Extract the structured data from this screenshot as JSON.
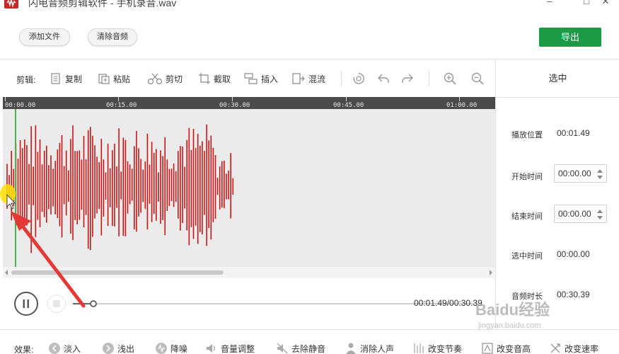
{
  "window": {
    "title": "闪电音频剪辑软件 - 手机录音.wav",
    "controls": [
      "–",
      "□",
      "✕"
    ]
  },
  "topbar": {
    "add_file": "添加文件",
    "clear_audio": "清除音频",
    "export": "导出"
  },
  "toolbar": {
    "label": "剪辑:",
    "items": [
      {
        "label": "复制",
        "icon": "copy-icon"
      },
      {
        "label": "粘贴",
        "icon": "paste-icon"
      },
      {
        "label": "剪切",
        "icon": "scissors-icon"
      },
      {
        "label": "截取",
        "icon": "crop-icon"
      },
      {
        "label": "插入",
        "icon": "insert-icon"
      },
      {
        "label": "混流",
        "icon": "mix-icon"
      }
    ],
    "icon_buttons": [
      "reset-icon",
      "undo-icon",
      "redo-icon",
      "zoom-in-icon",
      "zoom-out-icon"
    ]
  },
  "timeline": {
    "ticks": [
      "00:00.00",
      "00:15.00",
      "00:30.00",
      "00:45.00",
      "01:00.00"
    ]
  },
  "right_panel": {
    "header": "选中",
    "play_position_label": "播放位置",
    "play_position_value": "00:01.49",
    "start_time_label": "开始时间",
    "start_time_value": "00:00.00",
    "end_time_label": "结束时间",
    "end_time_value": "00:00.00",
    "selected_time_label": "选中时间",
    "selected_time_value": "00:00.00",
    "duration_label": "音频时长",
    "duration_value": "00:30.39"
  },
  "playback": {
    "time": "00:01.49/00:30.39",
    "progress": 0.05
  },
  "effects": {
    "label": "效果:",
    "items": [
      {
        "label": "淡入",
        "icon": "fade-in-icon"
      },
      {
        "label": "浅出",
        "icon": "fade-out-icon"
      },
      {
        "label": "降噪",
        "icon": "denoise-icon"
      },
      {
        "label": "音量调整",
        "icon": "volume-icon"
      },
      {
        "label": "去除静音",
        "icon": "mute-icon"
      },
      {
        "label": "消除人声",
        "icon": "vocal-remove-icon"
      },
      {
        "label": "改变节奏",
        "icon": "tempo-icon"
      },
      {
        "label": "改变音高",
        "icon": "pitch-icon"
      },
      {
        "label": "改变速率",
        "icon": "speed-icon"
      }
    ]
  },
  "watermark": {
    "main": "Baidu经验",
    "sub": "jingyan.baidu.com"
  },
  "colors": {
    "waveform": "#cc1414",
    "playhead": "#4caf50",
    "export": "#1c9a46",
    "arrow": "#e53935"
  }
}
